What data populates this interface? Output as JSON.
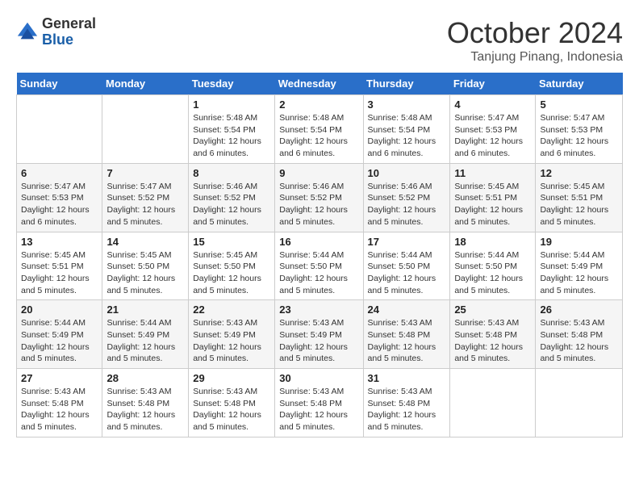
{
  "logo": {
    "general": "General",
    "blue": "Blue"
  },
  "title": {
    "month_year": "October 2024",
    "location": "Tanjung Pinang, Indonesia"
  },
  "headers": [
    "Sunday",
    "Monday",
    "Tuesday",
    "Wednesday",
    "Thursday",
    "Friday",
    "Saturday"
  ],
  "weeks": [
    [
      {
        "day": "",
        "sunrise": "",
        "sunset": "",
        "daylight": ""
      },
      {
        "day": "",
        "sunrise": "",
        "sunset": "",
        "daylight": ""
      },
      {
        "day": "1",
        "sunrise": "Sunrise: 5:48 AM",
        "sunset": "Sunset: 5:54 PM",
        "daylight": "Daylight: 12 hours and 6 minutes."
      },
      {
        "day": "2",
        "sunrise": "Sunrise: 5:48 AM",
        "sunset": "Sunset: 5:54 PM",
        "daylight": "Daylight: 12 hours and 6 minutes."
      },
      {
        "day": "3",
        "sunrise": "Sunrise: 5:48 AM",
        "sunset": "Sunset: 5:54 PM",
        "daylight": "Daylight: 12 hours and 6 minutes."
      },
      {
        "day": "4",
        "sunrise": "Sunrise: 5:47 AM",
        "sunset": "Sunset: 5:53 PM",
        "daylight": "Daylight: 12 hours and 6 minutes."
      },
      {
        "day": "5",
        "sunrise": "Sunrise: 5:47 AM",
        "sunset": "Sunset: 5:53 PM",
        "daylight": "Daylight: 12 hours and 6 minutes."
      }
    ],
    [
      {
        "day": "6",
        "sunrise": "Sunrise: 5:47 AM",
        "sunset": "Sunset: 5:53 PM",
        "daylight": "Daylight: 12 hours and 6 minutes."
      },
      {
        "day": "7",
        "sunrise": "Sunrise: 5:47 AM",
        "sunset": "Sunset: 5:52 PM",
        "daylight": "Daylight: 12 hours and 5 minutes."
      },
      {
        "day": "8",
        "sunrise": "Sunrise: 5:46 AM",
        "sunset": "Sunset: 5:52 PM",
        "daylight": "Daylight: 12 hours and 5 minutes."
      },
      {
        "day": "9",
        "sunrise": "Sunrise: 5:46 AM",
        "sunset": "Sunset: 5:52 PM",
        "daylight": "Daylight: 12 hours and 5 minutes."
      },
      {
        "day": "10",
        "sunrise": "Sunrise: 5:46 AM",
        "sunset": "Sunset: 5:52 PM",
        "daylight": "Daylight: 12 hours and 5 minutes."
      },
      {
        "day": "11",
        "sunrise": "Sunrise: 5:45 AM",
        "sunset": "Sunset: 5:51 PM",
        "daylight": "Daylight: 12 hours and 5 minutes."
      },
      {
        "day": "12",
        "sunrise": "Sunrise: 5:45 AM",
        "sunset": "Sunset: 5:51 PM",
        "daylight": "Daylight: 12 hours and 5 minutes."
      }
    ],
    [
      {
        "day": "13",
        "sunrise": "Sunrise: 5:45 AM",
        "sunset": "Sunset: 5:51 PM",
        "daylight": "Daylight: 12 hours and 5 minutes."
      },
      {
        "day": "14",
        "sunrise": "Sunrise: 5:45 AM",
        "sunset": "Sunset: 5:50 PM",
        "daylight": "Daylight: 12 hours and 5 minutes."
      },
      {
        "day": "15",
        "sunrise": "Sunrise: 5:45 AM",
        "sunset": "Sunset: 5:50 PM",
        "daylight": "Daylight: 12 hours and 5 minutes."
      },
      {
        "day": "16",
        "sunrise": "Sunrise: 5:44 AM",
        "sunset": "Sunset: 5:50 PM",
        "daylight": "Daylight: 12 hours and 5 minutes."
      },
      {
        "day": "17",
        "sunrise": "Sunrise: 5:44 AM",
        "sunset": "Sunset: 5:50 PM",
        "daylight": "Daylight: 12 hours and 5 minutes."
      },
      {
        "day": "18",
        "sunrise": "Sunrise: 5:44 AM",
        "sunset": "Sunset: 5:50 PM",
        "daylight": "Daylight: 12 hours and 5 minutes."
      },
      {
        "day": "19",
        "sunrise": "Sunrise: 5:44 AM",
        "sunset": "Sunset: 5:49 PM",
        "daylight": "Daylight: 12 hours and 5 minutes."
      }
    ],
    [
      {
        "day": "20",
        "sunrise": "Sunrise: 5:44 AM",
        "sunset": "Sunset: 5:49 PM",
        "daylight": "Daylight: 12 hours and 5 minutes."
      },
      {
        "day": "21",
        "sunrise": "Sunrise: 5:44 AM",
        "sunset": "Sunset: 5:49 PM",
        "daylight": "Daylight: 12 hours and 5 minutes."
      },
      {
        "day": "22",
        "sunrise": "Sunrise: 5:43 AM",
        "sunset": "Sunset: 5:49 PM",
        "daylight": "Daylight: 12 hours and 5 minutes."
      },
      {
        "day": "23",
        "sunrise": "Sunrise: 5:43 AM",
        "sunset": "Sunset: 5:49 PM",
        "daylight": "Daylight: 12 hours and 5 minutes."
      },
      {
        "day": "24",
        "sunrise": "Sunrise: 5:43 AM",
        "sunset": "Sunset: 5:48 PM",
        "daylight": "Daylight: 12 hours and 5 minutes."
      },
      {
        "day": "25",
        "sunrise": "Sunrise: 5:43 AM",
        "sunset": "Sunset: 5:48 PM",
        "daylight": "Daylight: 12 hours and 5 minutes."
      },
      {
        "day": "26",
        "sunrise": "Sunrise: 5:43 AM",
        "sunset": "Sunset: 5:48 PM",
        "daylight": "Daylight: 12 hours and 5 minutes."
      }
    ],
    [
      {
        "day": "27",
        "sunrise": "Sunrise: 5:43 AM",
        "sunset": "Sunset: 5:48 PM",
        "daylight": "Daylight: 12 hours and 5 minutes."
      },
      {
        "day": "28",
        "sunrise": "Sunrise: 5:43 AM",
        "sunset": "Sunset: 5:48 PM",
        "daylight": "Daylight: 12 hours and 5 minutes."
      },
      {
        "day": "29",
        "sunrise": "Sunrise: 5:43 AM",
        "sunset": "Sunset: 5:48 PM",
        "daylight": "Daylight: 12 hours and 5 minutes."
      },
      {
        "day": "30",
        "sunrise": "Sunrise: 5:43 AM",
        "sunset": "Sunset: 5:48 PM",
        "daylight": "Daylight: 12 hours and 5 minutes."
      },
      {
        "day": "31",
        "sunrise": "Sunrise: 5:43 AM",
        "sunset": "Sunset: 5:48 PM",
        "daylight": "Daylight: 12 hours and 5 minutes."
      },
      {
        "day": "",
        "sunrise": "",
        "sunset": "",
        "daylight": ""
      },
      {
        "day": "",
        "sunrise": "",
        "sunset": "",
        "daylight": ""
      }
    ]
  ]
}
